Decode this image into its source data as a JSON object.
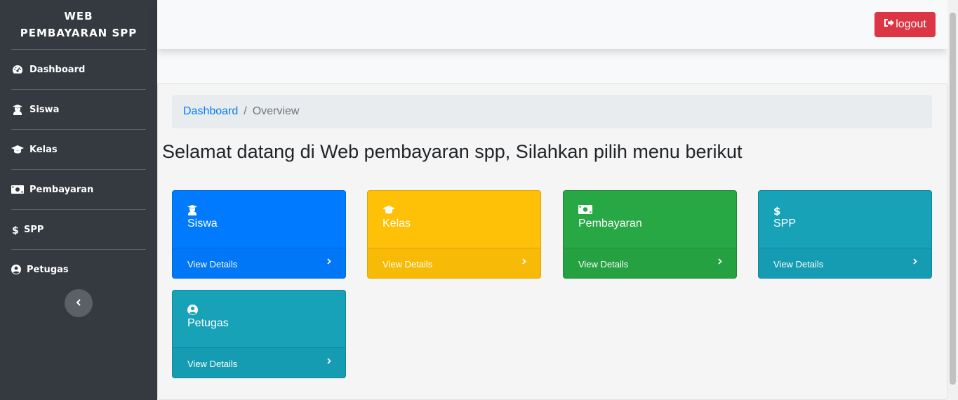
{
  "brand": {
    "line1": "WEB",
    "line2": "PEMBAYARAN SPP"
  },
  "sidebar": {
    "items": [
      {
        "label": "Dashboard",
        "icon": "tachometer-icon"
      },
      {
        "label": "Siswa",
        "icon": "user-graduate-icon"
      },
      {
        "label": "Kelas",
        "icon": "graduation-cap-icon"
      },
      {
        "label": "Pembayaran",
        "icon": "money-bill-icon"
      },
      {
        "label": "SPP",
        "icon": "dollar-icon"
      },
      {
        "label": "Petugas",
        "icon": "user-circle-icon"
      }
    ],
    "toggle_icon": "chevron-left-icon"
  },
  "topbar": {
    "logout_label": "logout",
    "logout_icon": "sign-out-icon"
  },
  "breadcrumb": {
    "link": "Dashboard",
    "separator": "/",
    "active": "Overview"
  },
  "welcome_text": "Selamat datang di Web pembayaran spp, Silahkan pilih menu berikut",
  "cards": [
    {
      "title": "Siswa",
      "footer": "View Details",
      "icon": "user-graduate-icon",
      "color": "#007bff"
    },
    {
      "title": "Kelas",
      "footer": "View Details",
      "icon": "graduation-cap-icon",
      "color": "#ffc107"
    },
    {
      "title": "Pembayaran",
      "footer": "View Details",
      "icon": "money-bill-icon",
      "color": "#28a745"
    },
    {
      "title": "SPP",
      "footer": "View Details",
      "icon": "dollar-icon",
      "color": "#17a2b8"
    },
    {
      "title": "Petugas",
      "footer": "View Details",
      "icon": "user-circle-icon",
      "color": "#17a2b8"
    }
  ],
  "colors": {
    "sidebar_bg": "#343a40",
    "logout_bg": "#dc3545",
    "link": "#007bff"
  }
}
